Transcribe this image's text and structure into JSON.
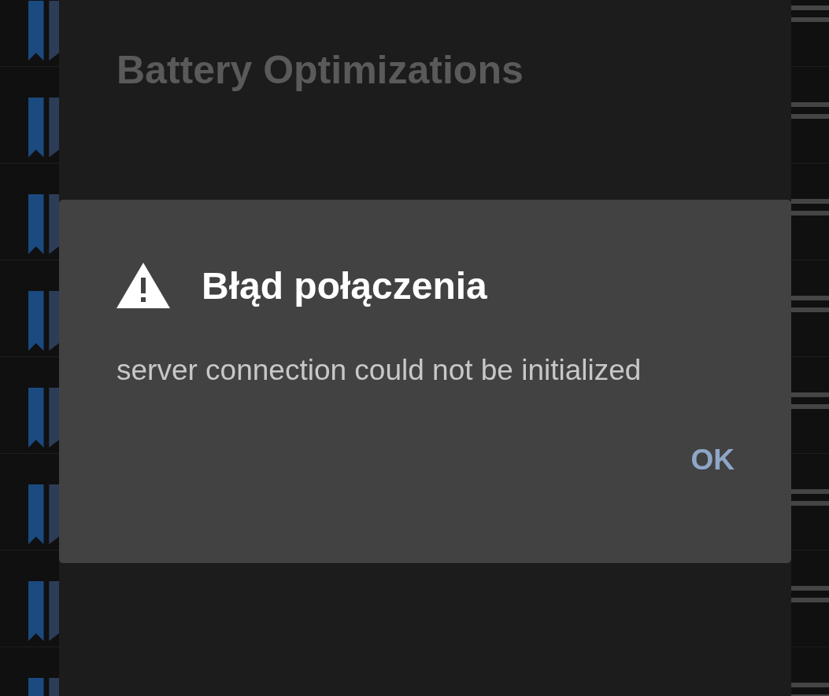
{
  "background_dialog": {
    "title": "Battery Optimizations"
  },
  "dialog": {
    "title": "Błąd połączenia",
    "message": "server connection could not be initialized",
    "buttons": [
      "OK"
    ]
  }
}
